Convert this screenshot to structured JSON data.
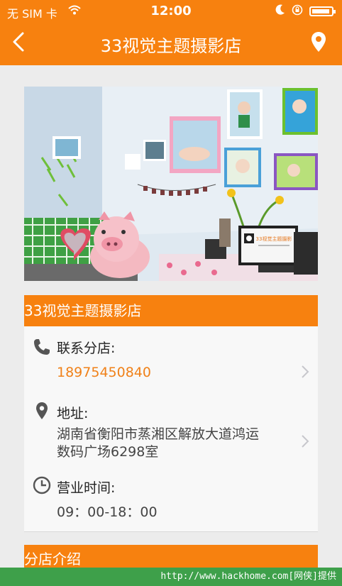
{
  "status_bar": {
    "carrier": "无 SIM 卡",
    "time": "12:00"
  },
  "header": {
    "title": "33视觉主题摄影店",
    "back_icon": "chevron-left-icon",
    "location_icon": "map-pin-icon"
  },
  "store": {
    "name": "33视觉主题摄影店",
    "contact_label": "联系分店:",
    "phone": "18975450840",
    "address_label": "地址:",
    "address": "湖南省衡阳市蒸湘区解放大道鸿运数码广场6298室",
    "address_line1": "湖南省衡阳市蒸湘区解放大道鸿运",
    "address_line2": "数码广场6298室",
    "hours_label": "营业时间:",
    "hours": "09：00-18：00"
  },
  "intro_section": {
    "title": "分店介绍"
  },
  "photo": {
    "sign_text": "33视觉主题摄影"
  },
  "watermark": "http://www.hackhome.com[网侠]提供",
  "colors": {
    "accent": "#f7810f",
    "phone_text": "#f08119",
    "footer": "#3ea04a"
  }
}
